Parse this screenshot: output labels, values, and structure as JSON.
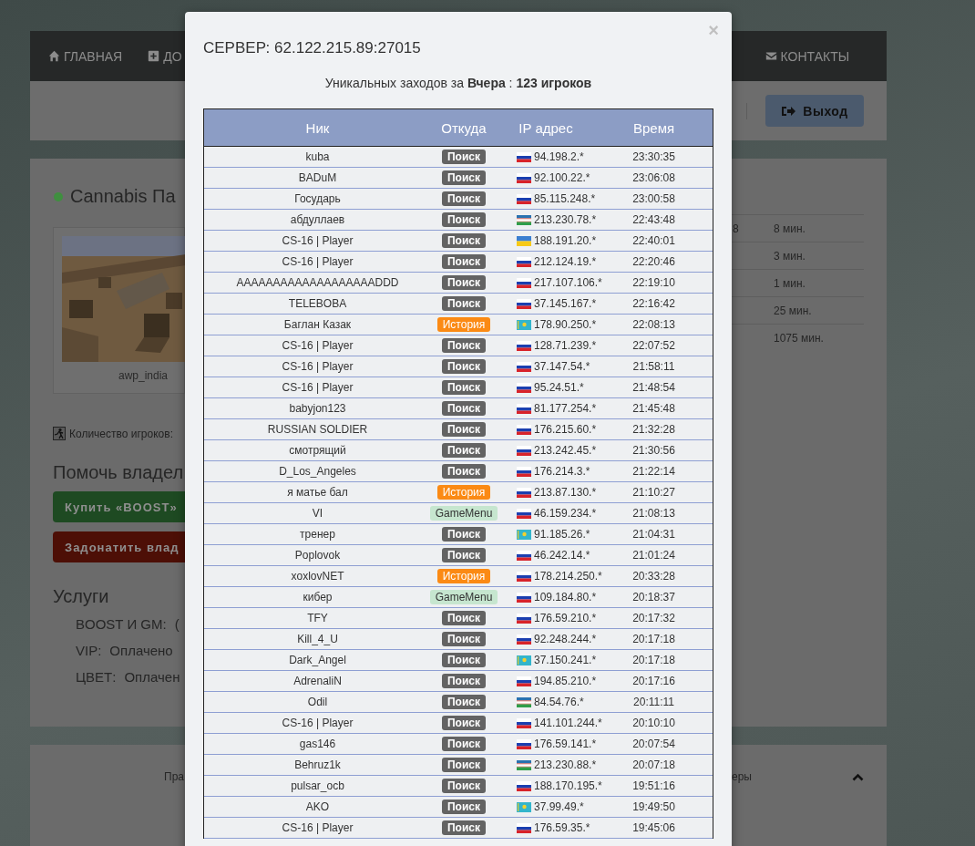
{
  "nav": {
    "items": [
      {
        "label": "ГЛАВНАЯ",
        "kind": "home"
      },
      {
        "label": "ДО",
        "kind": "add"
      },
      {
        "label": "КОНТАКТЫ",
        "kind": "mail"
      }
    ]
  },
  "toolbar": {
    "logout_button": "Выход"
  },
  "server_card": {
    "status_dot": {
      "color": "#3f8f3f"
    },
    "title": "Cannabis Па",
    "map_caption": "awp_india",
    "players_label": "Количество игроков:",
    "help_heading": "Помочь владел",
    "buttons": [
      {
        "label": "Купить «BOOST»",
        "kind": "green"
      },
      {
        "label": "Задонатить влад",
        "kind": "red"
      }
    ],
    "services_heading": "Услуги",
    "services": [
      {
        "name": "BOOST И GM:",
        "value": "("
      },
      {
        "name": "VIP:",
        "value": "Оплачено"
      },
      {
        "name": "ЦВЕТ:",
        "value": "Оплачен"
      }
    ],
    "stats_rows": [
      {
        "column_1": "8",
        "column_2": "8 мин."
      },
      {
        "column_2": "3 мин."
      },
      {
        "column_2": "1 мин."
      },
      {
        "column_2": "25 мин."
      },
      {
        "column_2": "1075 мин."
      }
    ]
  },
  "footer": {
    "left_text": "Пра",
    "right_text": "еры"
  },
  "modal": {
    "title": "СЕРВЕР: 62.122.215.89:27015",
    "subtitle": "Уникальных заходов за **Вчера** : **123 игроков**",
    "close": "×",
    "columns": [
      "Ник",
      "Откуда",
      "IP адрес",
      "Время"
    ],
    "rows": [
      {
        "nick": "kuba",
        "source": {
          "label": "Поиск",
          "kind": "search"
        },
        "flag": {
          "kind": "ru"
        },
        "ip": "94.198.2.*",
        "time": "23:30:35"
      },
      {
        "nick": "BADuM",
        "source": {
          "label": "Поиск",
          "kind": "search"
        },
        "flag": {
          "kind": "ru"
        },
        "ip": "92.100.22.*",
        "time": "23:06:08"
      },
      {
        "nick": "Государь",
        "source": {
          "label": "Поиск",
          "kind": "search"
        },
        "flag": {
          "kind": "ru"
        },
        "ip": "85.115.248.*",
        "time": "23:00:58"
      },
      {
        "nick": "абдуллаев",
        "source": {
          "label": "Поиск",
          "kind": "search"
        },
        "flag": {
          "kind": "uz"
        },
        "ip": "213.230.78.*",
        "time": "22:43:48"
      },
      {
        "nick": "CS-16 | Player",
        "source": {
          "label": "Поиск",
          "kind": "search"
        },
        "flag": {
          "kind": "ua"
        },
        "ip": "188.191.20.*",
        "time": "22:40:01"
      },
      {
        "nick": "CS-16 | Player",
        "source": {
          "label": "Поиск",
          "kind": "search"
        },
        "flag": {
          "kind": "ru"
        },
        "ip": "212.124.19.*",
        "time": "22:20:46"
      },
      {
        "nick": "AAAAAAAAAAAAAAAAAAADDD",
        "source": {
          "label": "Поиск",
          "kind": "search"
        },
        "flag": {
          "kind": "ru"
        },
        "ip": "217.107.106.*",
        "time": "22:19:10"
      },
      {
        "nick": "TELEBOBA",
        "source": {
          "label": "Поиск",
          "kind": "search"
        },
        "flag": {
          "kind": "ru"
        },
        "ip": "37.145.167.*",
        "time": "22:16:42"
      },
      {
        "nick": "Баглан Казак",
        "source": {
          "label": "История",
          "kind": "history"
        },
        "flag": {
          "kind": "kz"
        },
        "ip": "178.90.250.*",
        "time": "22:08:13"
      },
      {
        "nick": "CS-16 | Player",
        "source": {
          "label": "Поиск",
          "kind": "search"
        },
        "flag": {
          "kind": "ru"
        },
        "ip": "128.71.239.*",
        "time": "22:07:52"
      },
      {
        "nick": "CS-16 | Player",
        "source": {
          "label": "Поиск",
          "kind": "search"
        },
        "flag": {
          "kind": "ru"
        },
        "ip": "37.147.54.*",
        "time": "21:58:11"
      },
      {
        "nick": "CS-16 | Player",
        "source": {
          "label": "Поиск",
          "kind": "search"
        },
        "flag": {
          "kind": "ru"
        },
        "ip": "95.24.51.*",
        "time": "21:48:54"
      },
      {
        "nick": "babyjon123",
        "source": {
          "label": "Поиск",
          "kind": "search"
        },
        "flag": {
          "kind": "ru"
        },
        "ip": "81.177.254.*",
        "time": "21:45:48"
      },
      {
        "nick": "RUSSIAN SOLDIER",
        "source": {
          "label": "Поиск",
          "kind": "search"
        },
        "flag": {
          "kind": "ru"
        },
        "ip": "176.215.60.*",
        "time": "21:32:28"
      },
      {
        "nick": "смотрящий",
        "source": {
          "label": "Поиск",
          "kind": "search"
        },
        "flag": {
          "kind": "ru"
        },
        "ip": "213.242.45.*",
        "time": "21:30:56"
      },
      {
        "nick": "D_Los_Angeles",
        "source": {
          "label": "Поиск",
          "kind": "search"
        },
        "flag": {
          "kind": "ru"
        },
        "ip": "176.214.3.*",
        "time": "21:22:14"
      },
      {
        "nick": "я матье бал",
        "source": {
          "label": "История",
          "kind": "history"
        },
        "flag": {
          "kind": "ru"
        },
        "ip": "213.87.130.*",
        "time": "21:10:27"
      },
      {
        "nick": "VI",
        "source": {
          "label": "GameMenu",
          "kind": "gamemenu"
        },
        "flag": {
          "kind": "ru"
        },
        "ip": "46.159.234.*",
        "time": "21:08:13"
      },
      {
        "nick": "тренер",
        "source": {
          "label": "Поиск",
          "kind": "search"
        },
        "flag": {
          "kind": "kz"
        },
        "ip": "91.185.26.*",
        "time": "21:04:31"
      },
      {
        "nick": "Poplovok",
        "source": {
          "label": "Поиск",
          "kind": "search"
        },
        "flag": {
          "kind": "ru"
        },
        "ip": "46.242.14.*",
        "time": "21:01:24"
      },
      {
        "nick": "xoxlovNET",
        "source": {
          "label": "История",
          "kind": "history"
        },
        "flag": {
          "kind": "ru"
        },
        "ip": "178.214.250.*",
        "time": "20:33:28"
      },
      {
        "nick": "кибер",
        "source": {
          "label": "GameMenu",
          "kind": "gamemenu"
        },
        "flag": {
          "kind": "ru"
        },
        "ip": "109.184.80.*",
        "time": "20:18:37"
      },
      {
        "nick": "TFY",
        "source": {
          "label": "Поиск",
          "kind": "search"
        },
        "flag": {
          "kind": "ru"
        },
        "ip": "176.59.210.*",
        "time": "20:17:32"
      },
      {
        "nick": "Kill_4_U",
        "source": {
          "label": "Поиск",
          "kind": "search"
        },
        "flag": {
          "kind": "ru"
        },
        "ip": "92.248.244.*",
        "time": "20:17:18"
      },
      {
        "nick": "Dark_Angel",
        "source": {
          "label": "Поиск",
          "kind": "search"
        },
        "flag": {
          "kind": "kz"
        },
        "ip": "37.150.241.*",
        "time": "20:17:18"
      },
      {
        "nick": "AdrenaliN",
        "source": {
          "label": "Поиск",
          "kind": "search"
        },
        "flag": {
          "kind": "ru"
        },
        "ip": "194.85.210.*",
        "time": "20:17:16"
      },
      {
        "nick": "Odil",
        "source": {
          "label": "Поиск",
          "kind": "search"
        },
        "flag": {
          "kind": "uz"
        },
        "ip": "84.54.76.*",
        "time": "20:11:11"
      },
      {
        "nick": "CS-16 | Player",
        "source": {
          "label": "Поиск",
          "kind": "search"
        },
        "flag": {
          "kind": "ru"
        },
        "ip": "141.101.244.*",
        "time": "20:10:10"
      },
      {
        "nick": "gas146",
        "source": {
          "label": "Поиск",
          "kind": "search"
        },
        "flag": {
          "kind": "ru"
        },
        "ip": "176.59.141.*",
        "time": "20:07:54"
      },
      {
        "nick": "Behruz1k",
        "source": {
          "label": "Поиск",
          "kind": "search"
        },
        "flag": {
          "kind": "uz"
        },
        "ip": "213.230.88.*",
        "time": "20:07:18"
      },
      {
        "nick": "pulsar_ocb",
        "source": {
          "label": "Поиск",
          "kind": "search"
        },
        "flag": {
          "kind": "ru"
        },
        "ip": "188.170.195.*",
        "time": "19:51:16"
      },
      {
        "nick": "AKO",
        "source": {
          "label": "Поиск",
          "kind": "search"
        },
        "flag": {
          "kind": "kz"
        },
        "ip": "37.99.49.*",
        "time": "19:49:50"
      },
      {
        "nick": "CS-16 | Player",
        "source": {
          "label": "Поиск",
          "kind": "search"
        },
        "flag": {
          "kind": "ru"
        },
        "ip": "176.59.35.*",
        "time": "19:45:06"
      }
    ]
  }
}
